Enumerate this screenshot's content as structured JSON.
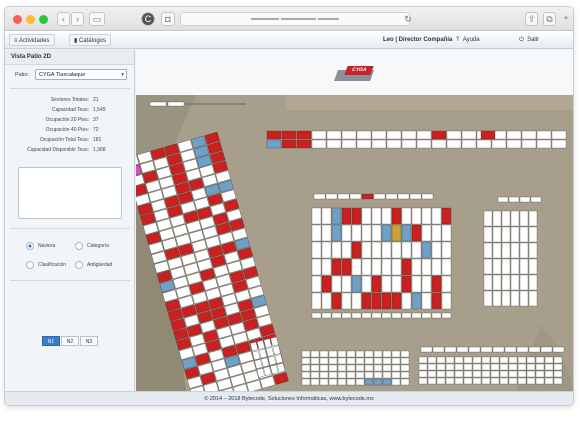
{
  "nav": {
    "actividades": "Actividades",
    "catalogos": "Catálogos",
    "user": "Leo | Director Compañía",
    "ayuda": "Ayuda",
    "salir": "Salir"
  },
  "sidebar": {
    "title": "Vista Patio 2D",
    "patio_label": "Patio:",
    "patio_value": "CYGA Tlaxcalaque",
    "stats": [
      {
        "label": "Sectores Totales:",
        "value": "21"
      },
      {
        "label": "Capacidad Teus:",
        "value": "1,549"
      },
      {
        "label": "Ocupación 20 Pies:",
        "value": "37"
      },
      {
        "label": "Ocupación 40 Pies:",
        "value": "72"
      },
      {
        "label": "Ocupación Total Teus:",
        "value": "181"
      },
      {
        "label": "Capacidad Disponible Teus:",
        "value": "1,368"
      }
    ],
    "view_options": {
      "naviera": "Naviera",
      "categoria": "Categoría",
      "clasificacion": "Clasificación",
      "antiguedad": "Antigüedad",
      "selected": "naviera"
    },
    "levels": [
      "N1",
      "N2",
      "N3"
    ],
    "active_level": "N1"
  },
  "logo_text": "CYGA",
  "footer": "© 2014 – 2018 Bytecode, Soluciones Informáticas, www.bytecode.mx",
  "colors": {
    "occupied": "#cc1f1f",
    "empty": "#ffffff",
    "reefer": "#6fa0c8",
    "special": "#e048c8",
    "hazard": "#c8a23a"
  }
}
